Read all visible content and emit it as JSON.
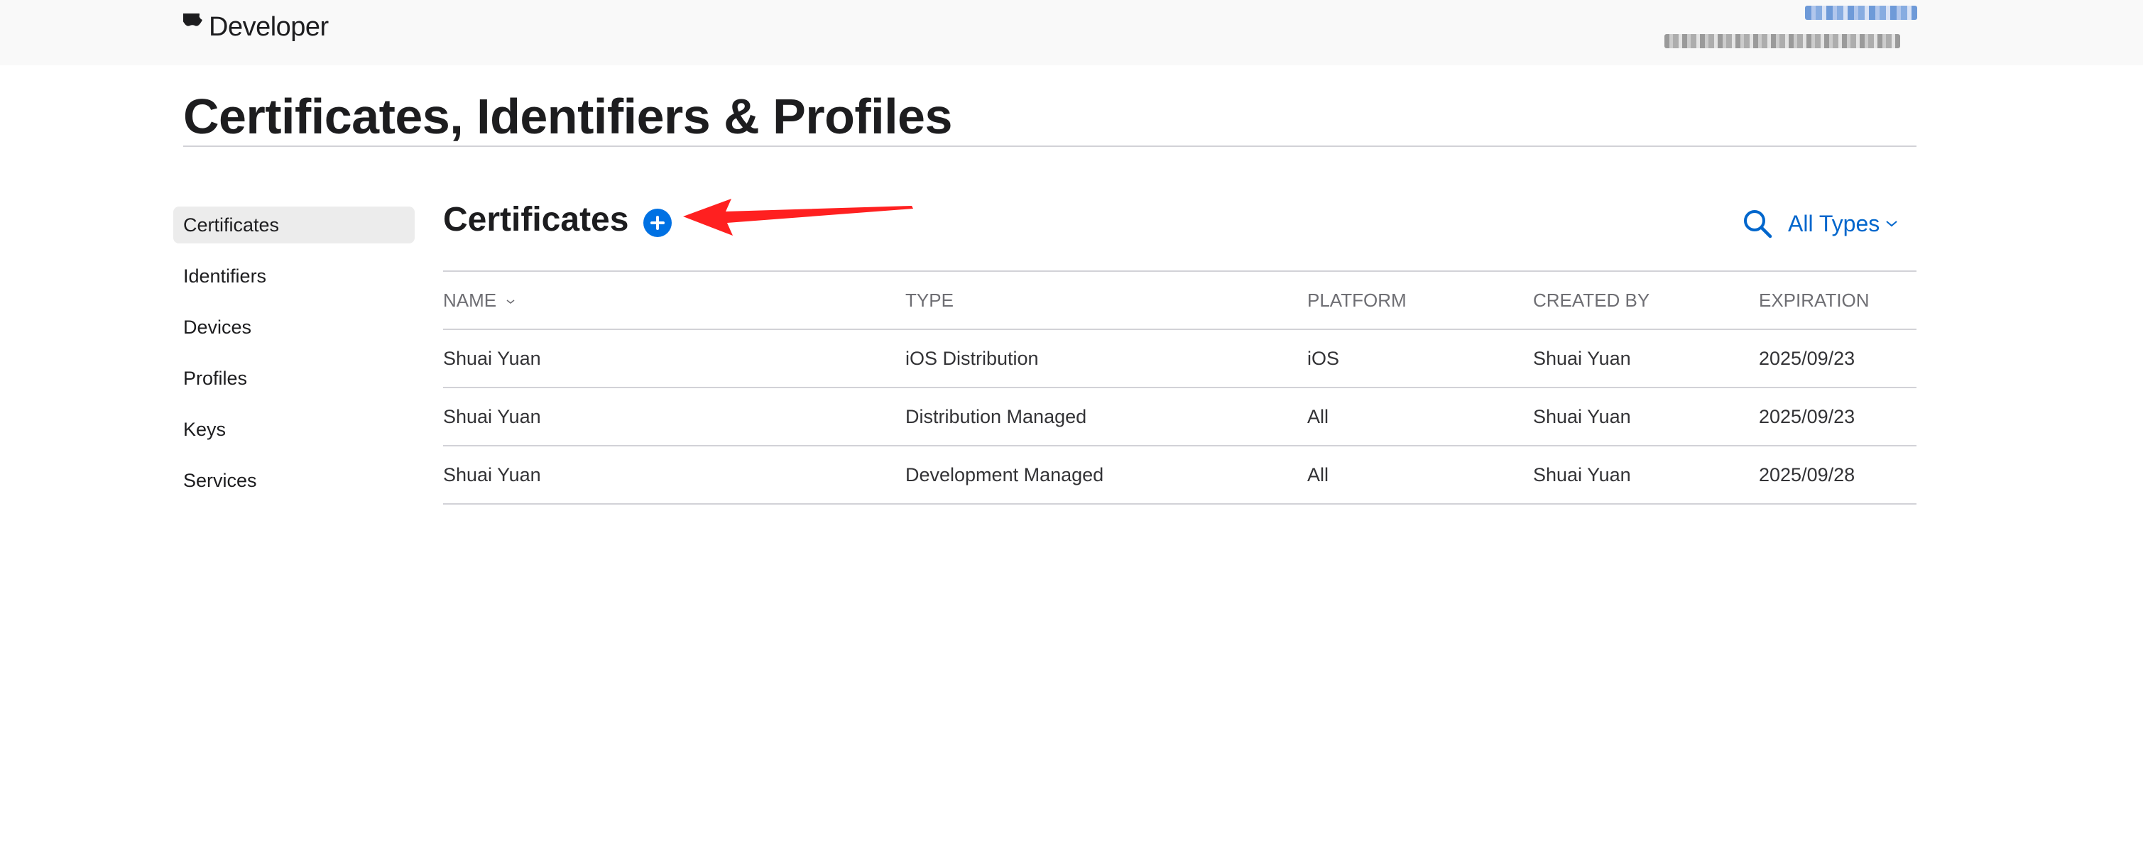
{
  "header": {
    "brand": "Developer"
  },
  "page_title": "Certificates, Identifiers & Profiles",
  "sidebar": {
    "items": [
      {
        "label": "Certificates",
        "active": true
      },
      {
        "label": "Identifiers"
      },
      {
        "label": "Devices"
      },
      {
        "label": "Profiles"
      },
      {
        "label": "Keys"
      },
      {
        "label": "Services"
      }
    ]
  },
  "main": {
    "section_title": "Certificates",
    "filter_label": "All Types",
    "icons": {
      "add": "plus-circle-icon",
      "search": "search-icon",
      "filter_chevron": "chevron-down-icon",
      "sort": "chevron-down-icon",
      "annotation": "red-arrow"
    },
    "colors": {
      "accent": "#0071e3",
      "link": "#0066cc",
      "annotation": "#ff2020"
    }
  },
  "table": {
    "columns": [
      "NAME",
      "TYPE",
      "PLATFORM",
      "CREATED BY",
      "EXPIRATION"
    ],
    "rows": [
      [
        "Shuai Yuan",
        "iOS Distribution",
        "iOS",
        "Shuai Yuan",
        "2025/09/23"
      ],
      [
        "Shuai Yuan",
        "Distribution Managed",
        "All",
        "Shuai Yuan",
        "2025/09/23"
      ],
      [
        "Shuai Yuan",
        "Development Managed",
        "All",
        "Shuai Yuan",
        "2025/09/28"
      ]
    ]
  }
}
